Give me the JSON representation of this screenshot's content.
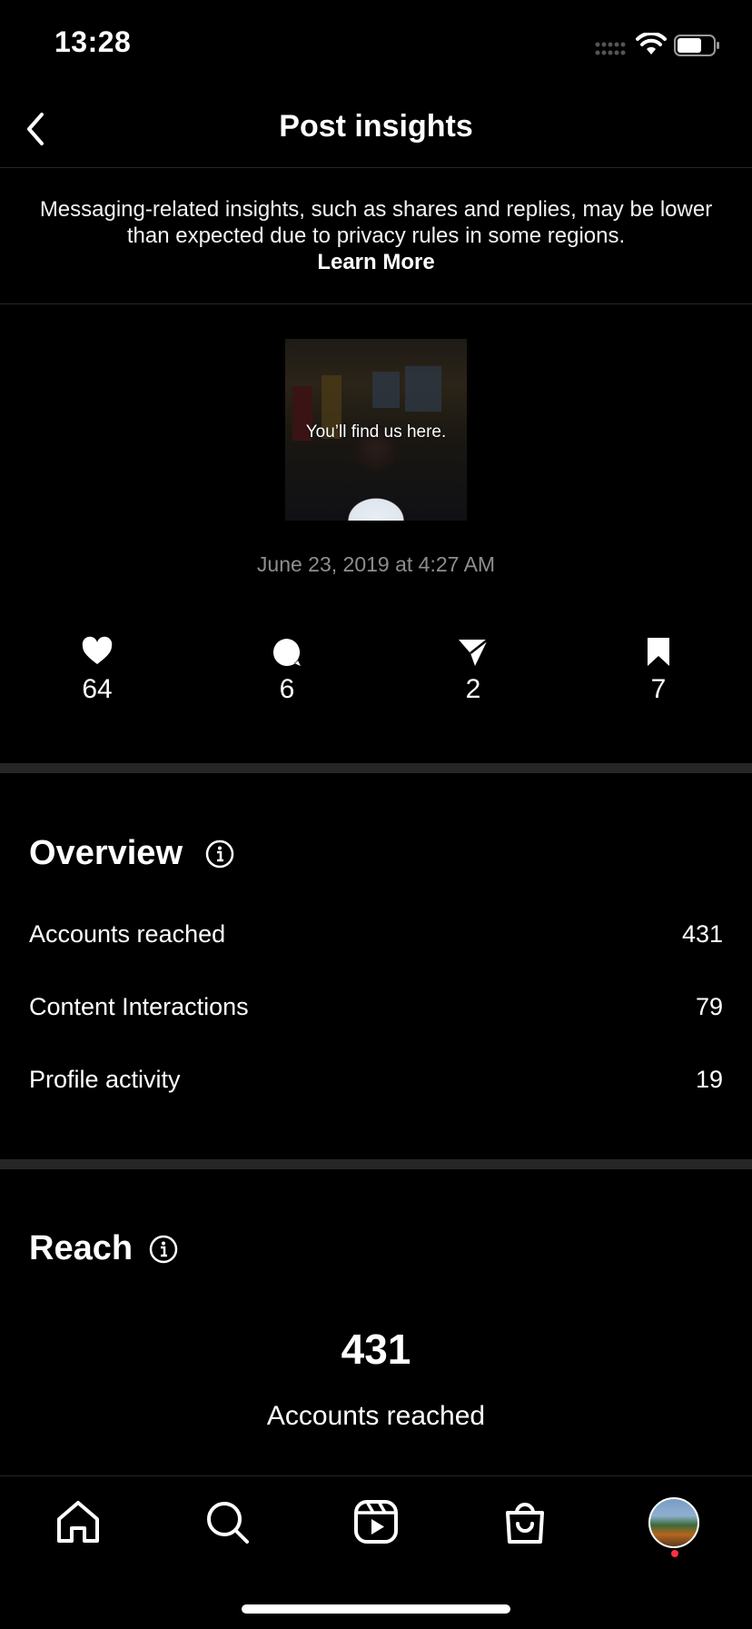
{
  "status_bar": {
    "time": "13:28"
  },
  "header": {
    "title": "Post insights"
  },
  "notice": {
    "text": "Messaging-related insights, such as shares and replies, may be lower than expected due to privacy rules in some regions.",
    "link": "Learn More"
  },
  "post": {
    "caption_overlay": "You’ll find us here.",
    "date": "June 23, 2019 at 4:27 AM"
  },
  "stats": [
    {
      "icon": "heart-icon",
      "value": "64"
    },
    {
      "icon": "comment-icon",
      "value": "6"
    },
    {
      "icon": "share-icon",
      "value": "2"
    },
    {
      "icon": "bookmark-icon",
      "value": "7"
    }
  ],
  "overview": {
    "title": "Overview",
    "rows": [
      {
        "label": "Accounts reached",
        "value": "431"
      },
      {
        "label": "Content Interactions",
        "value": "79"
      },
      {
        "label": "Profile activity",
        "value": "19"
      }
    ]
  },
  "reach": {
    "title": "Reach",
    "value": "431",
    "label": "Accounts reached"
  },
  "tabbar": [
    "home-icon",
    "search-icon",
    "reels-icon",
    "shop-icon",
    "profile-avatar"
  ],
  "colors": {
    "background": "#000000",
    "separator": "#262626",
    "muted": "#8e8e8e",
    "notification": "#ff3040"
  }
}
